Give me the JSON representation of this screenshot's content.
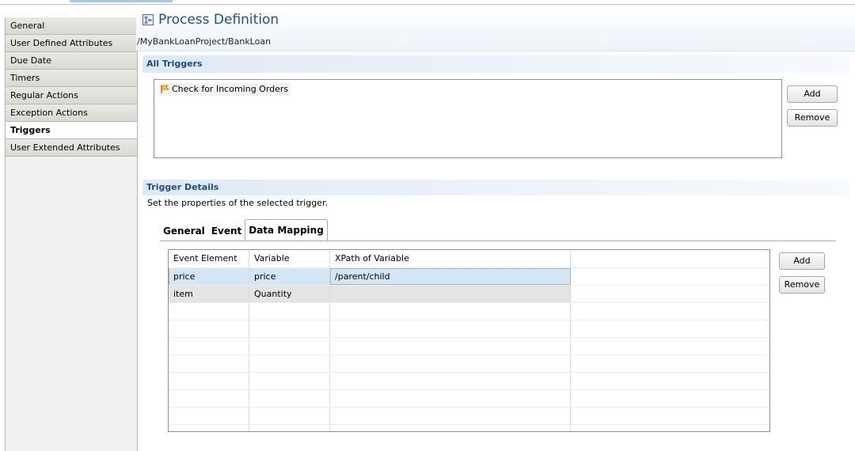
{
  "sidebar": {
    "items": [
      {
        "label": "General"
      },
      {
        "label": "User Defined Attributes"
      },
      {
        "label": "Due Date"
      },
      {
        "label": "Timers"
      },
      {
        "label": "Regular Actions"
      },
      {
        "label": "Exception Actions"
      },
      {
        "label": "Triggers"
      },
      {
        "label": "User Extended Attributes"
      }
    ],
    "active": "Triggers"
  },
  "header": {
    "title": "Process Definition",
    "breadcrumb": "/MyBankLoanProject/BankLoan",
    "icon": "process-definition-icon"
  },
  "all_triggers": {
    "section_title": "All Triggers",
    "items": [
      {
        "label": "Check for Incoming Orders",
        "icon": "trigger-icon"
      }
    ],
    "add_label": "Add",
    "remove_label": "Remove"
  },
  "trigger_details": {
    "section_title": "Trigger Details",
    "subtitle": "Set the properties of the selected trigger.",
    "tabs": [
      {
        "label": "General"
      },
      {
        "label": "Event"
      },
      {
        "label": "Data Mapping"
      }
    ],
    "active_tab": "Data Mapping",
    "table": {
      "columns": [
        "Event Element",
        "Variable",
        "XPath of Variable",
        ""
      ],
      "rows": [
        [
          "price",
          "price",
          "/parent/child",
          ""
        ],
        [
          "item",
          "Quantity",
          "",
          ""
        ]
      ],
      "selected_row": 0
    },
    "add_label": "Add",
    "remove_label": "Remove"
  },
  "colors": {
    "title_blue": "#1d4f86",
    "selection": "#d2e6f6"
  }
}
